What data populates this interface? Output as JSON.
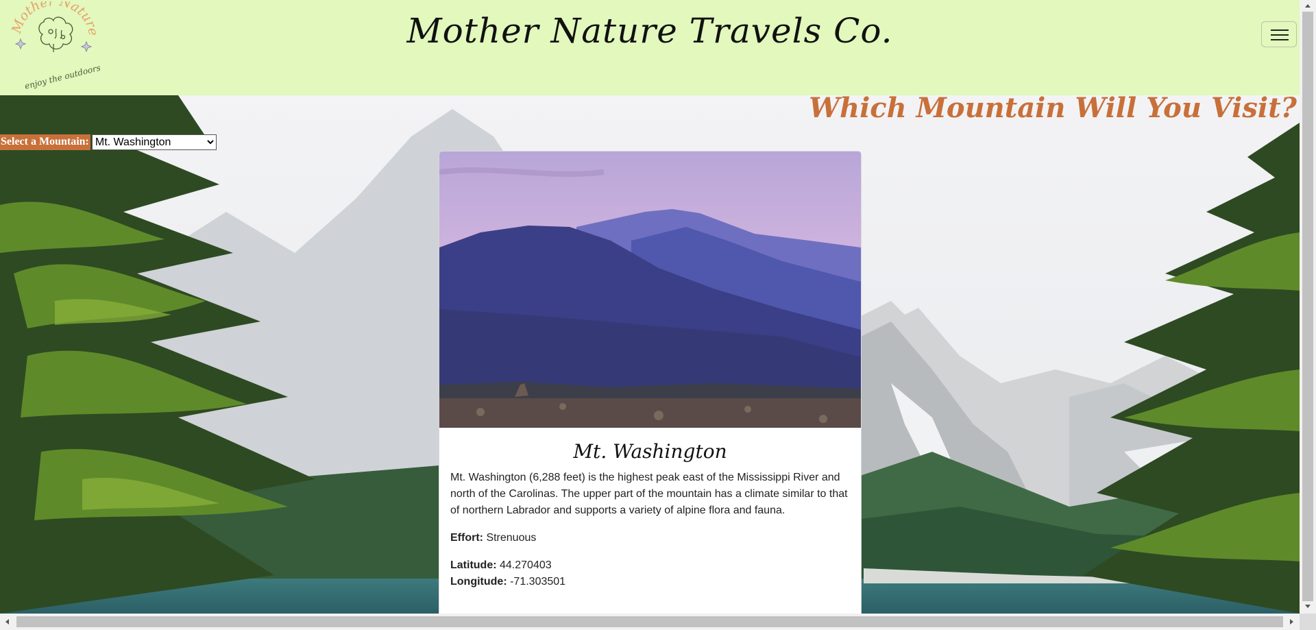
{
  "header": {
    "logo_text": "Mother Nature",
    "logo_tagline": "enjoy the outdoors!",
    "site_title": "Mother Nature Travels Co.",
    "menu_icon": "hamburger-icon",
    "background_color": "#e2f8bc"
  },
  "page": {
    "heading": "Which Mountain Will You Visit?",
    "accent_color": "#c8703a"
  },
  "selector": {
    "label": "Select a Mountain:",
    "selected": "Mt. Washington"
  },
  "card": {
    "title": "Mt. Washington",
    "description": "Mt. Washington (6,288 feet) is the highest peak east of the Mississippi River and north of the Carolinas. The upper part of the mountain has a climate similar to that of northern Labrador and supports a variety of alpine flora and fauna.",
    "effort_label": "Effort:",
    "effort_value": "Strenuous",
    "latitude_label": "Latitude:",
    "latitude_value": "44.270403",
    "longitude_label": "Longitude:",
    "longitude_value": "-71.303501"
  }
}
